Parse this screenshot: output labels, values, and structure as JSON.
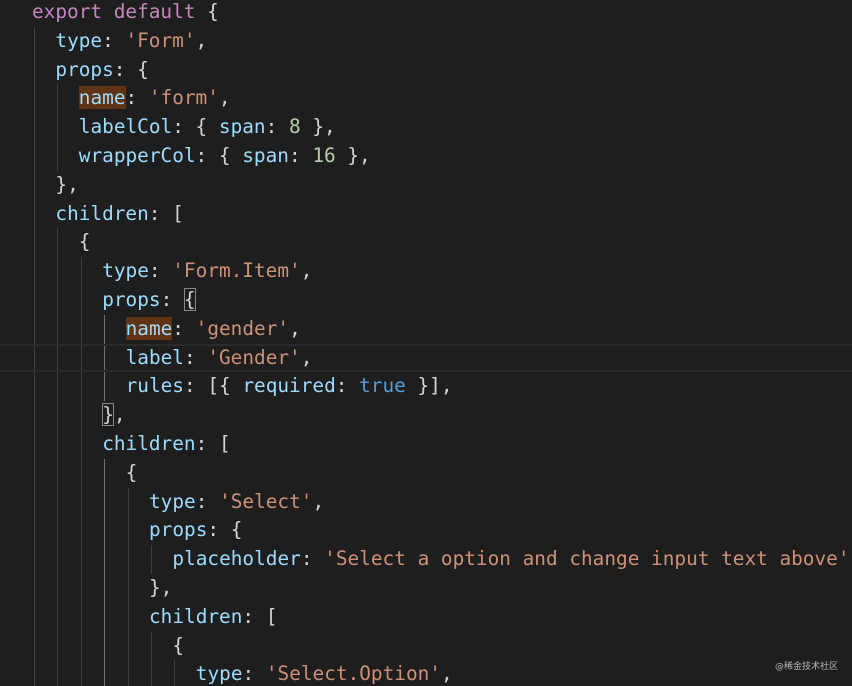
{
  "lines": [
    {
      "indent": 0,
      "tokens": [
        [
          "kw",
          "export"
        ],
        [
          "pn",
          " "
        ],
        [
          "kw",
          "default"
        ],
        [
          "pn",
          " {"
        ]
      ]
    },
    {
      "indent": 1,
      "tokens": [
        [
          "prop",
          "type"
        ],
        [
          "pn",
          ": "
        ],
        [
          "str",
          "'Form'"
        ],
        [
          "pn",
          ","
        ]
      ]
    },
    {
      "indent": 1,
      "tokens": [
        [
          "prop",
          "props"
        ],
        [
          "pn",
          ": {"
        ]
      ]
    },
    {
      "indent": 2,
      "tokens": [
        [
          "prop hl",
          "name"
        ],
        [
          "pn",
          ": "
        ],
        [
          "str",
          "'form'"
        ],
        [
          "pn",
          ","
        ]
      ]
    },
    {
      "indent": 2,
      "tokens": [
        [
          "prop",
          "labelCol"
        ],
        [
          "pn",
          ": { "
        ],
        [
          "prop",
          "span"
        ],
        [
          "pn",
          ": "
        ],
        [
          "num",
          "8"
        ],
        [
          "pn",
          " },"
        ]
      ]
    },
    {
      "indent": 2,
      "tokens": [
        [
          "prop",
          "wrapperCol"
        ],
        [
          "pn",
          ": { "
        ],
        [
          "prop",
          "span"
        ],
        [
          "pn",
          ": "
        ],
        [
          "num",
          "16"
        ],
        [
          "pn",
          " },"
        ]
      ]
    },
    {
      "indent": 1,
      "tokens": [
        [
          "pn",
          "},"
        ]
      ]
    },
    {
      "indent": 1,
      "tokens": [
        [
          "prop",
          "children"
        ],
        [
          "pn",
          ": ["
        ]
      ]
    },
    {
      "indent": 2,
      "tokens": [
        [
          "pn",
          "{"
        ]
      ]
    },
    {
      "indent": 3,
      "tokens": [
        [
          "prop",
          "type"
        ],
        [
          "pn",
          ": "
        ],
        [
          "str",
          "'Form.Item'"
        ],
        [
          "pn",
          ","
        ]
      ]
    },
    {
      "indent": 3,
      "tokens": [
        [
          "prop",
          "props"
        ],
        [
          "pn",
          ": "
        ],
        [
          "pn box",
          "{"
        ]
      ]
    },
    {
      "indent": 4,
      "tokens": [
        [
          "prop hl",
          "name"
        ],
        [
          "pn",
          ": "
        ],
        [
          "str",
          "'gender'"
        ],
        [
          "pn",
          ","
        ]
      ]
    },
    {
      "indent": 4,
      "current": true,
      "tokens": [
        [
          "prop",
          "label"
        ],
        [
          "pn",
          ": "
        ],
        [
          "str",
          "'Gender'"
        ],
        [
          "pn",
          ","
        ]
      ]
    },
    {
      "indent": 4,
      "tokens": [
        [
          "prop",
          "rules"
        ],
        [
          "pn",
          ": [{ "
        ],
        [
          "prop",
          "required"
        ],
        [
          "pn",
          ": "
        ],
        [
          "bool",
          "true"
        ],
        [
          "pn",
          " }],"
        ]
      ]
    },
    {
      "indent": 3,
      "tokens": [
        [
          "pn box",
          "}"
        ],
        [
          "pn",
          ","
        ]
      ]
    },
    {
      "indent": 3,
      "tokens": [
        [
          "prop",
          "children"
        ],
        [
          "pn",
          ": ["
        ]
      ]
    },
    {
      "indent": 4,
      "tokens": [
        [
          "pn",
          "{"
        ]
      ]
    },
    {
      "indent": 5,
      "tokens": [
        [
          "prop",
          "type"
        ],
        [
          "pn",
          ": "
        ],
        [
          "str",
          "'Select'"
        ],
        [
          "pn",
          ","
        ]
      ]
    },
    {
      "indent": 5,
      "tokens": [
        [
          "prop",
          "props"
        ],
        [
          "pn",
          ": {"
        ]
      ]
    },
    {
      "indent": 6,
      "tokens": [
        [
          "prop",
          "placeholder"
        ],
        [
          "pn",
          ": "
        ],
        [
          "str",
          "'Select a option and change input text above'"
        ],
        [
          "pn",
          ","
        ]
      ]
    },
    {
      "indent": 5,
      "tokens": [
        [
          "pn",
          "},"
        ]
      ]
    },
    {
      "indent": 5,
      "tokens": [
        [
          "prop",
          "children"
        ],
        [
          "pn",
          ": ["
        ]
      ]
    },
    {
      "indent": 6,
      "tokens": [
        [
          "pn",
          "{"
        ]
      ]
    },
    {
      "indent": 7,
      "tokens": [
        [
          "prop",
          "type"
        ],
        [
          "pn",
          ": "
        ],
        [
          "str",
          "'Select.Option'"
        ],
        [
          "pn",
          ","
        ]
      ]
    }
  ],
  "active_indent_guide": 4,
  "watermark": "@稀金技术社区"
}
